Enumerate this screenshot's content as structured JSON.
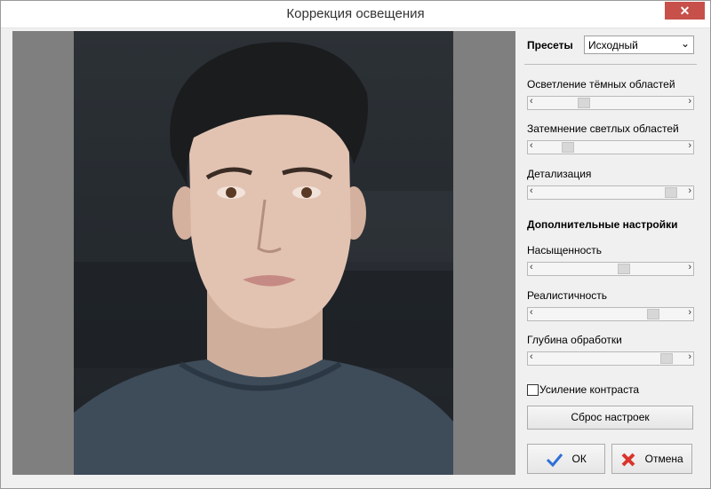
{
  "window": {
    "title": "Коррекция освещения",
    "close_glyph": "✕"
  },
  "panel": {
    "presets_label": "Пресеты",
    "preset_value": "Исходный",
    "sliders": [
      {
        "label": "Осветление тёмных областей",
        "value": 0.3
      },
      {
        "label": "Затемнение светлых областей",
        "value": 0.18
      },
      {
        "label": "Детализация",
        "value": 0.95
      }
    ],
    "advanced_title": "Дополнительные настройки",
    "advanced_sliders": [
      {
        "label": "Насыщенность",
        "value": 0.6
      },
      {
        "label": "Реалистичность",
        "value": 0.82
      },
      {
        "label": "Глубина обработки",
        "value": 0.92
      }
    ],
    "contrast_checkbox": {
      "label": "Усиление контраста",
      "checked": false
    },
    "reset_label": "Сброс настроек",
    "ok_label": "ОК",
    "cancel_label": "Отмена"
  },
  "colors": {
    "close_bg": "#c7504b",
    "ok_check": "#2f6fd6",
    "cancel_x": "#d9342b"
  },
  "icons": {
    "ok": "checkmark-icon",
    "cancel": "red-x-icon",
    "close": "close-icon"
  }
}
